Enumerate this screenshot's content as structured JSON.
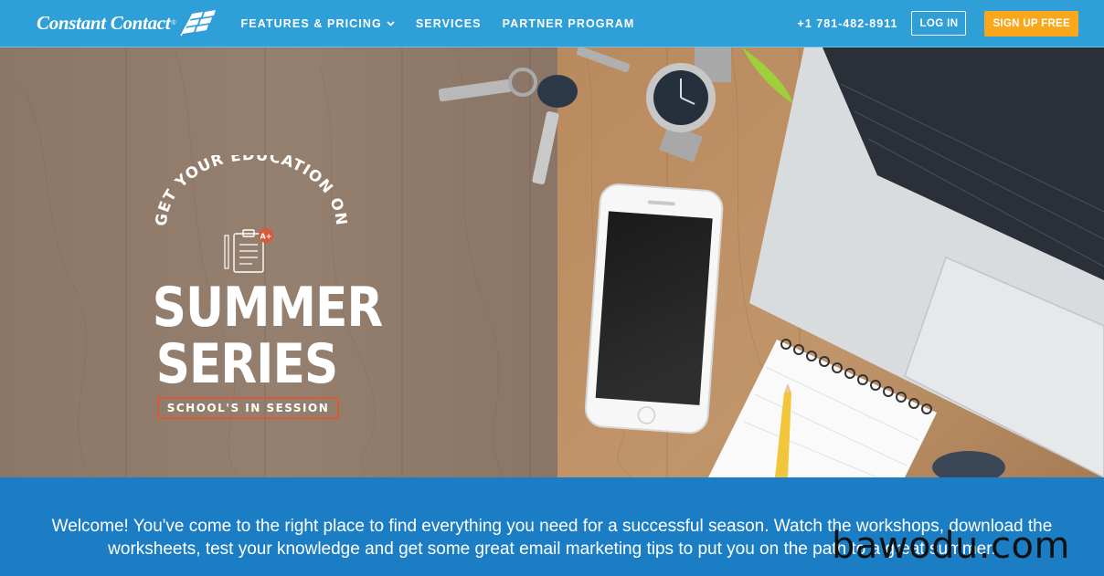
{
  "brand": {
    "name": "Constant Contact",
    "reg": "®"
  },
  "nav": {
    "items": [
      {
        "label": "FEATURES & PRICING",
        "has_dropdown": true
      },
      {
        "label": "SERVICES"
      },
      {
        "label": "PARTNER PROGRAM"
      }
    ],
    "phone": "+1 781-482-8911",
    "login_label": "LOG IN",
    "signup_label": "SIGN UP FREE"
  },
  "hero": {
    "arc_text": "GET YOUR EDUCATION ON",
    "badge_grade": "A+",
    "title_line1": "SUMMER",
    "title_line2": "SERIES",
    "subtitle": "SCHOOL'S IN SESSION"
  },
  "band": {
    "text": "Welcome! You've come to the right place to find everything you need for a successful season. Watch the workshops, download the worksheets, test your knowledge and get some great email marketing tips to put you on the path to a great summer."
  },
  "watermark": "bawodu.com",
  "colors": {
    "nav_bg": "#2f9fd8",
    "signup_bg": "#f9a81b",
    "band_bg": "#1b7dc4",
    "accent_red": "#d9593a"
  }
}
